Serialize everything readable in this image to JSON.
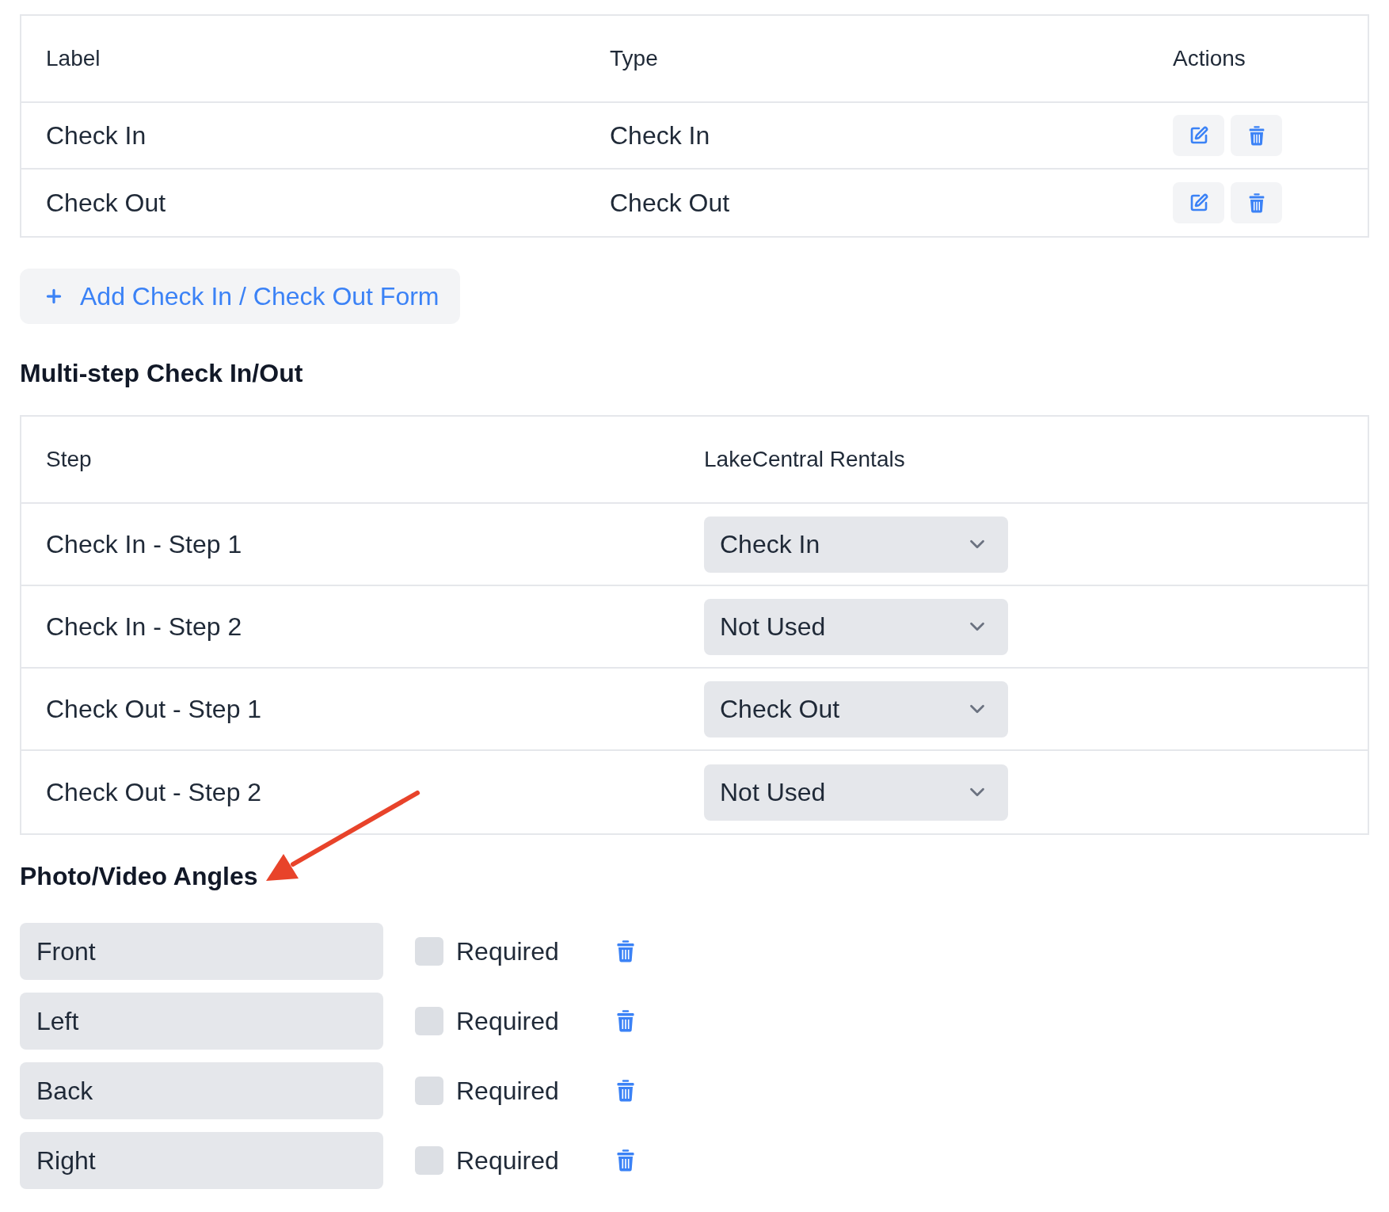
{
  "forms_table": {
    "columns": [
      "Label",
      "Type",
      "Actions"
    ],
    "rows": [
      {
        "label": "Check In",
        "type": "Check In"
      },
      {
        "label": "Check Out",
        "type": "Check Out"
      }
    ]
  },
  "add_form_button": {
    "label": "Add Check In / Check Out Form"
  },
  "multistep": {
    "title": "Multi-step Check In/Out",
    "columns": [
      "Step",
      "LakeCentral Rentals"
    ],
    "rows": [
      {
        "step": "Check In - Step 1",
        "value": "Check In"
      },
      {
        "step": "Check In - Step 2",
        "value": "Not Used"
      },
      {
        "step": "Check Out - Step 1",
        "value": "Check Out"
      },
      {
        "step": "Check Out - Step 2",
        "value": "Not Used"
      }
    ]
  },
  "angles": {
    "title": "Photo/Video Angles",
    "items": [
      {
        "name": "Front",
        "checked": false,
        "check_label": "Required"
      },
      {
        "name": "Left",
        "checked": false,
        "check_label": "Required"
      },
      {
        "name": "Back",
        "checked": false,
        "check_label": "Required"
      },
      {
        "name": "Right",
        "checked": false,
        "check_label": "Required"
      }
    ]
  }
}
